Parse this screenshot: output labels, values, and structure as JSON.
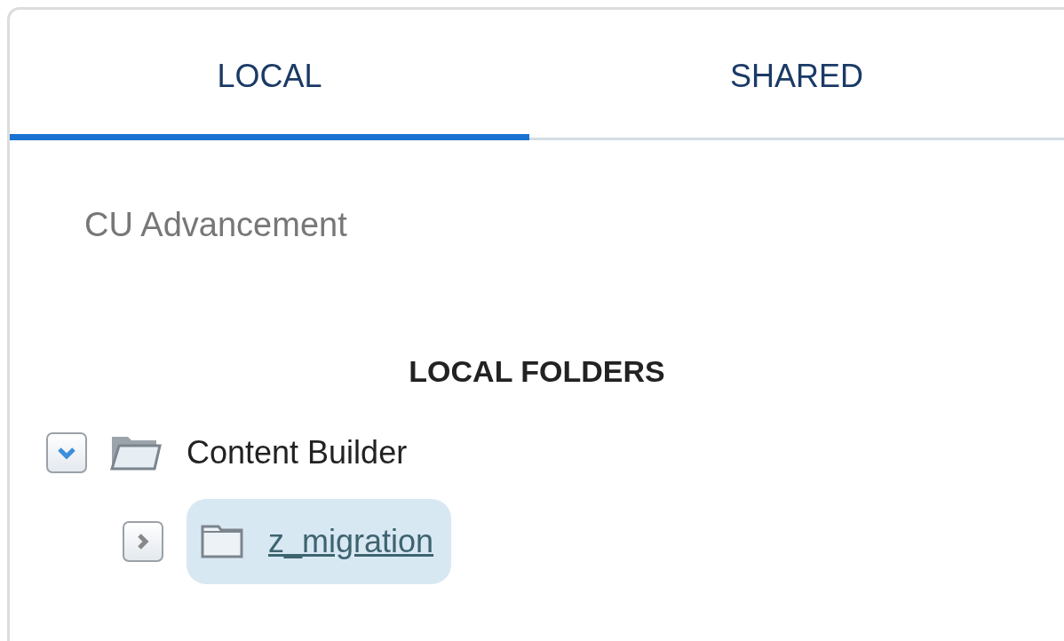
{
  "tabs": [
    {
      "label": "LOCAL",
      "selected": true
    },
    {
      "label": "SHARED",
      "selected": false
    }
  ],
  "account": "CU Advancement",
  "folders": {
    "heading": "LOCAL FOLDERS",
    "tree": [
      {
        "label": "Content Builder",
        "expanded": true,
        "selected": false,
        "children": [
          {
            "label": "z_migration",
            "expanded": false,
            "selected": true
          }
        ]
      }
    ]
  }
}
